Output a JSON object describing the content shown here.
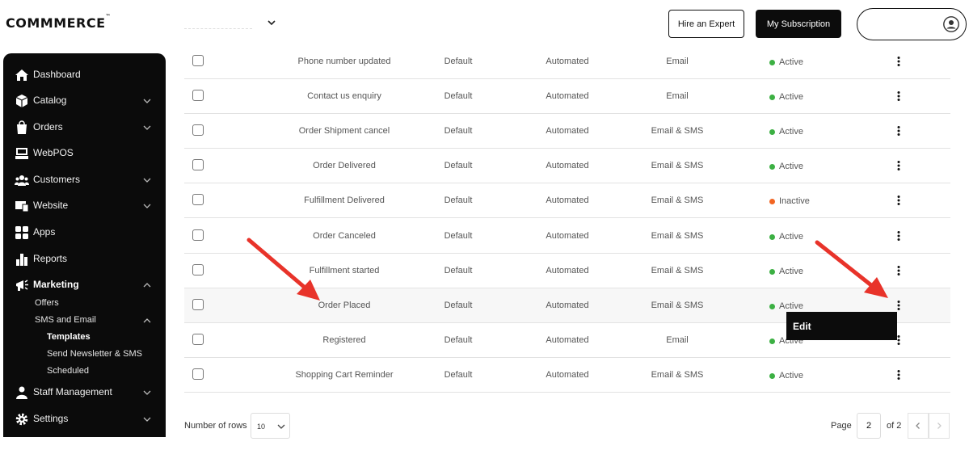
{
  "header": {
    "logo": "COMMMERCE",
    "logo_tm": "™",
    "hire_expert": "Hire an Expert",
    "subscription": "My Subscription"
  },
  "sidebar": {
    "items": [
      {
        "label": "Dashboard",
        "icon": "home-icon"
      },
      {
        "label": "Catalog",
        "icon": "catalog-icon"
      },
      {
        "label": "Orders",
        "icon": "orders-icon"
      },
      {
        "label": "WebPOS",
        "icon": "pos-icon"
      },
      {
        "label": "Customers",
        "icon": "customers-icon"
      },
      {
        "label": "Website",
        "icon": "website-icon"
      },
      {
        "label": "Apps",
        "icon": "apps-icon"
      },
      {
        "label": "Reports",
        "icon": "reports-icon"
      },
      {
        "label": "Marketing",
        "icon": "marketing-icon"
      },
      {
        "label": "Staff Management",
        "icon": "staff-icon"
      },
      {
        "label": "Settings",
        "icon": "settings-icon"
      }
    ],
    "marketing_sub": {
      "offers": "Offers",
      "sms_email": "SMS and Email",
      "templates": "Templates",
      "newsletter": "Send Newsletter & SMS",
      "scheduled": "Scheduled"
    }
  },
  "table": {
    "rows": [
      {
        "name": "Phone number updated",
        "type": "Default",
        "trigger": "Automated",
        "channel": "Email",
        "status": "Active"
      },
      {
        "name": "Contact us enquiry",
        "type": "Default",
        "trigger": "Automated",
        "channel": "Email",
        "status": "Active"
      },
      {
        "name": "Order Shipment cancel",
        "type": "Default",
        "trigger": "Automated",
        "channel": "Email & SMS",
        "status": "Active"
      },
      {
        "name": "Order Delivered",
        "type": "Default",
        "trigger": "Automated",
        "channel": "Email & SMS",
        "status": "Active"
      },
      {
        "name": "Fulfillment Delivered",
        "type": "Default",
        "trigger": "Automated",
        "channel": "Email & SMS",
        "status": "Inactive"
      },
      {
        "name": "Order Canceled",
        "type": "Default",
        "trigger": "Automated",
        "channel": "Email & SMS",
        "status": "Active"
      },
      {
        "name": "Fulfillment started",
        "type": "Default",
        "trigger": "Automated",
        "channel": "Email & SMS",
        "status": "Active"
      },
      {
        "name": "Order Placed",
        "type": "Default",
        "trigger": "Automated",
        "channel": "Email & SMS",
        "status": "Active"
      },
      {
        "name": "Registered",
        "type": "Default",
        "trigger": "Automated",
        "channel": "Email",
        "status": "Active"
      },
      {
        "name": "Shopping Cart Reminder",
        "type": "Default",
        "trigger": "Automated",
        "channel": "Email & SMS",
        "status": "Active"
      }
    ]
  },
  "context_menu": {
    "edit": "Edit"
  },
  "pagination": {
    "rows_label": "Number of rows",
    "rows_value": "10",
    "page_label": "Page",
    "page_value": "2",
    "of_label": "of 2"
  },
  "colors": {
    "active": "#3cb043",
    "inactive": "#f26522",
    "annotation": "#e8332a",
    "sidebar_bg": "#0b0b0b"
  }
}
